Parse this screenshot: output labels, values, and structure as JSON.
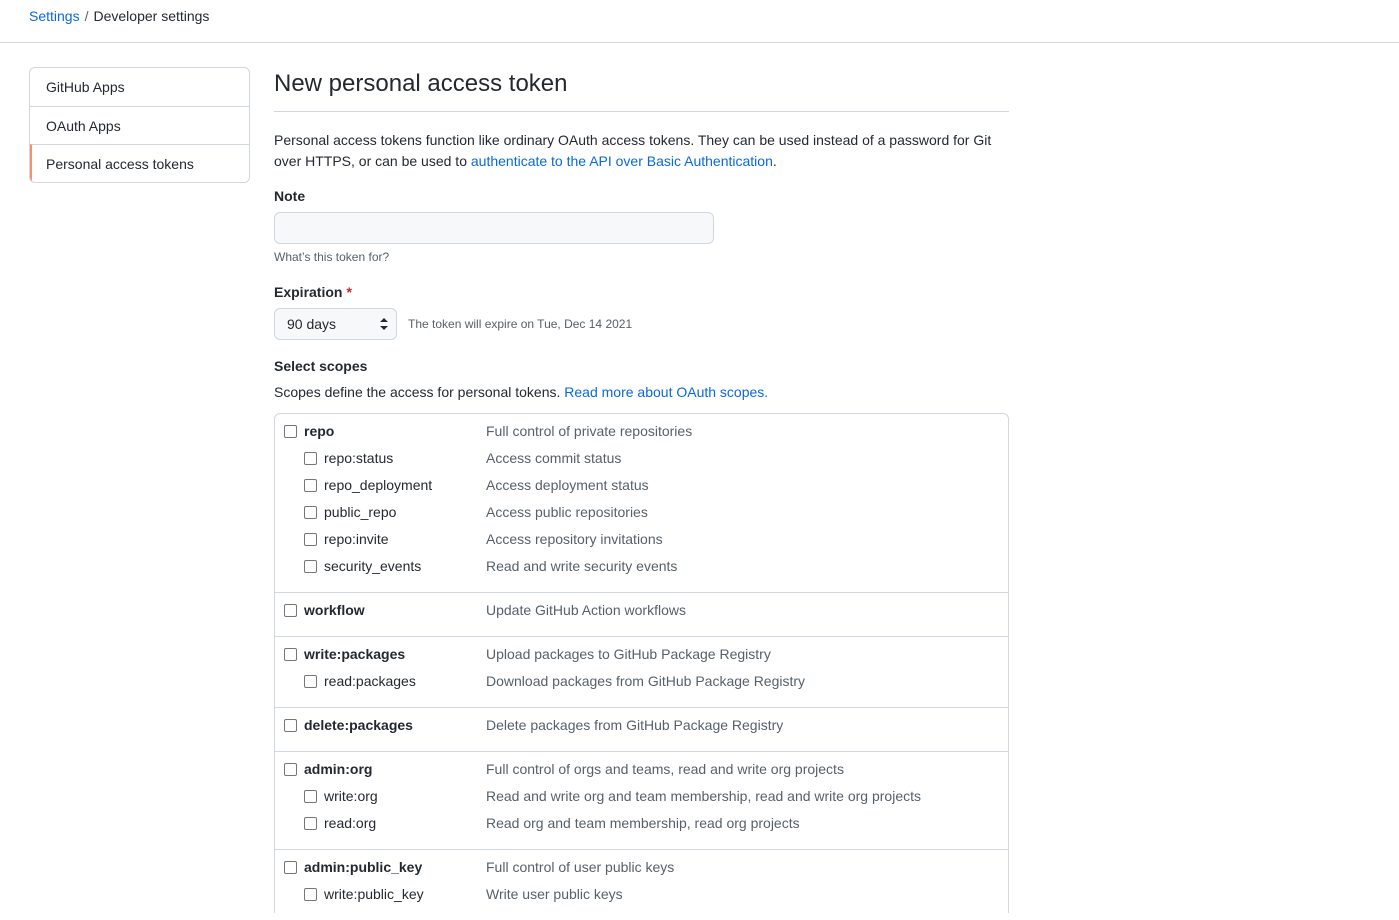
{
  "breadcrumb": {
    "settings": "Settings",
    "separator": "/",
    "current": "Developer settings"
  },
  "sidebar": {
    "items": [
      {
        "label": "GitHub Apps"
      },
      {
        "label": "OAuth Apps"
      },
      {
        "label": "Personal access tokens",
        "selected": true
      }
    ],
    "selected_accent": "#fd8c73"
  },
  "main": {
    "title": "New personal access token",
    "intro_text": "Personal access tokens function like ordinary OAuth access tokens. They can be used instead of a password for Git over HTTPS, or can be used to ",
    "intro_link": "authenticate to the API over Basic Authentication",
    "intro_end": ".",
    "note": {
      "label": "Note",
      "value": "",
      "hint": "What’s this token for?"
    },
    "expiration": {
      "label": "Expiration",
      "required_mark": "*",
      "selected": "90 days",
      "note": "The token will expire on Tue, Dec 14 2021"
    },
    "scopes": {
      "label": "Select scopes",
      "desc_text": "Scopes define the access for personal tokens. ",
      "desc_link": "Read more about OAuth scopes.",
      "groups": [
        {
          "name": "repo",
          "desc": "Full control of private repositories",
          "children": [
            {
              "name": "repo:status",
              "desc": "Access commit status"
            },
            {
              "name": "repo_deployment",
              "desc": "Access deployment status"
            },
            {
              "name": "public_repo",
              "desc": "Access public repositories"
            },
            {
              "name": "repo:invite",
              "desc": "Access repository invitations"
            },
            {
              "name": "security_events",
              "desc": "Read and write security events"
            }
          ]
        },
        {
          "name": "workflow",
          "desc": "Update GitHub Action workflows",
          "children": []
        },
        {
          "name": "write:packages",
          "desc": "Upload packages to GitHub Package Registry",
          "children": [
            {
              "name": "read:packages",
              "desc": "Download packages from GitHub Package Registry"
            }
          ]
        },
        {
          "name": "delete:packages",
          "desc": "Delete packages from GitHub Package Registry",
          "children": []
        },
        {
          "name": "admin:org",
          "desc": "Full control of orgs and teams, read and write org projects",
          "children": [
            {
              "name": "write:org",
              "desc": "Read and write org and team membership, read and write org projects"
            },
            {
              "name": "read:org",
              "desc": "Read org and team membership, read org projects"
            }
          ]
        },
        {
          "name": "admin:public_key",
          "desc": "Full control of user public keys",
          "children": [
            {
              "name": "write:public_key",
              "desc": "Write user public keys"
            }
          ]
        }
      ]
    }
  },
  "colors": {
    "link": "#0969da",
    "border": "#d0d7de",
    "required": "#cf222e"
  }
}
